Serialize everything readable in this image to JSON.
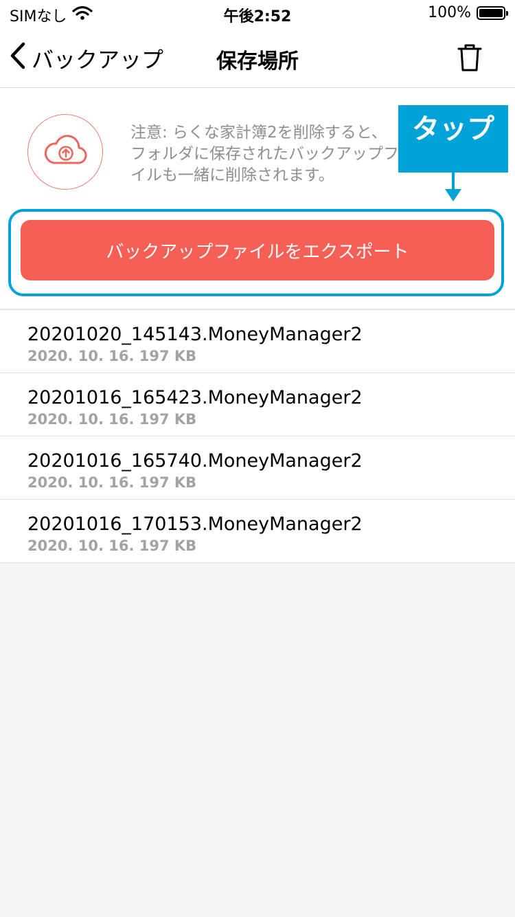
{
  "status_bar": {
    "carrier": "SIMなし",
    "time": "午後2:52",
    "battery": "100%",
    "wifi_icon": "wifi-icon",
    "battery_icon": "battery-icon"
  },
  "nav": {
    "back_label": "バックアップ",
    "title": "保存場所",
    "back_icon": "chevron-left-icon",
    "trash_icon": "trash-icon"
  },
  "notice": {
    "lines": [
      "注意: らくな家計簿2を削除すると、",
      "フォルダに保存されたバックアップフ",
      "イルも一緒に削除されます。"
    ],
    "icon": "cloud-upload-icon"
  },
  "callout": {
    "label": "タップ"
  },
  "export_button": {
    "label": "バックアップファイルをエクスポート"
  },
  "files": [
    {
      "name": "20201020_145143.MoneyManager2",
      "meta": "2020. 10. 16.  197 KB"
    },
    {
      "name": "20201016_165423.MoneyManager2",
      "meta": "2020. 10. 16.  197 KB"
    },
    {
      "name": "20201016_165740.MoneyManager2",
      "meta": "2020. 10. 16.  197 KB"
    },
    {
      "name": "20201016_170153.MoneyManager2",
      "meta": "2020. 10. 16.  197 KB"
    }
  ],
  "colors": {
    "accent_red": "#f65f56",
    "callout_blue": "#00a2d8",
    "secondary_text": "#8e8e93"
  }
}
